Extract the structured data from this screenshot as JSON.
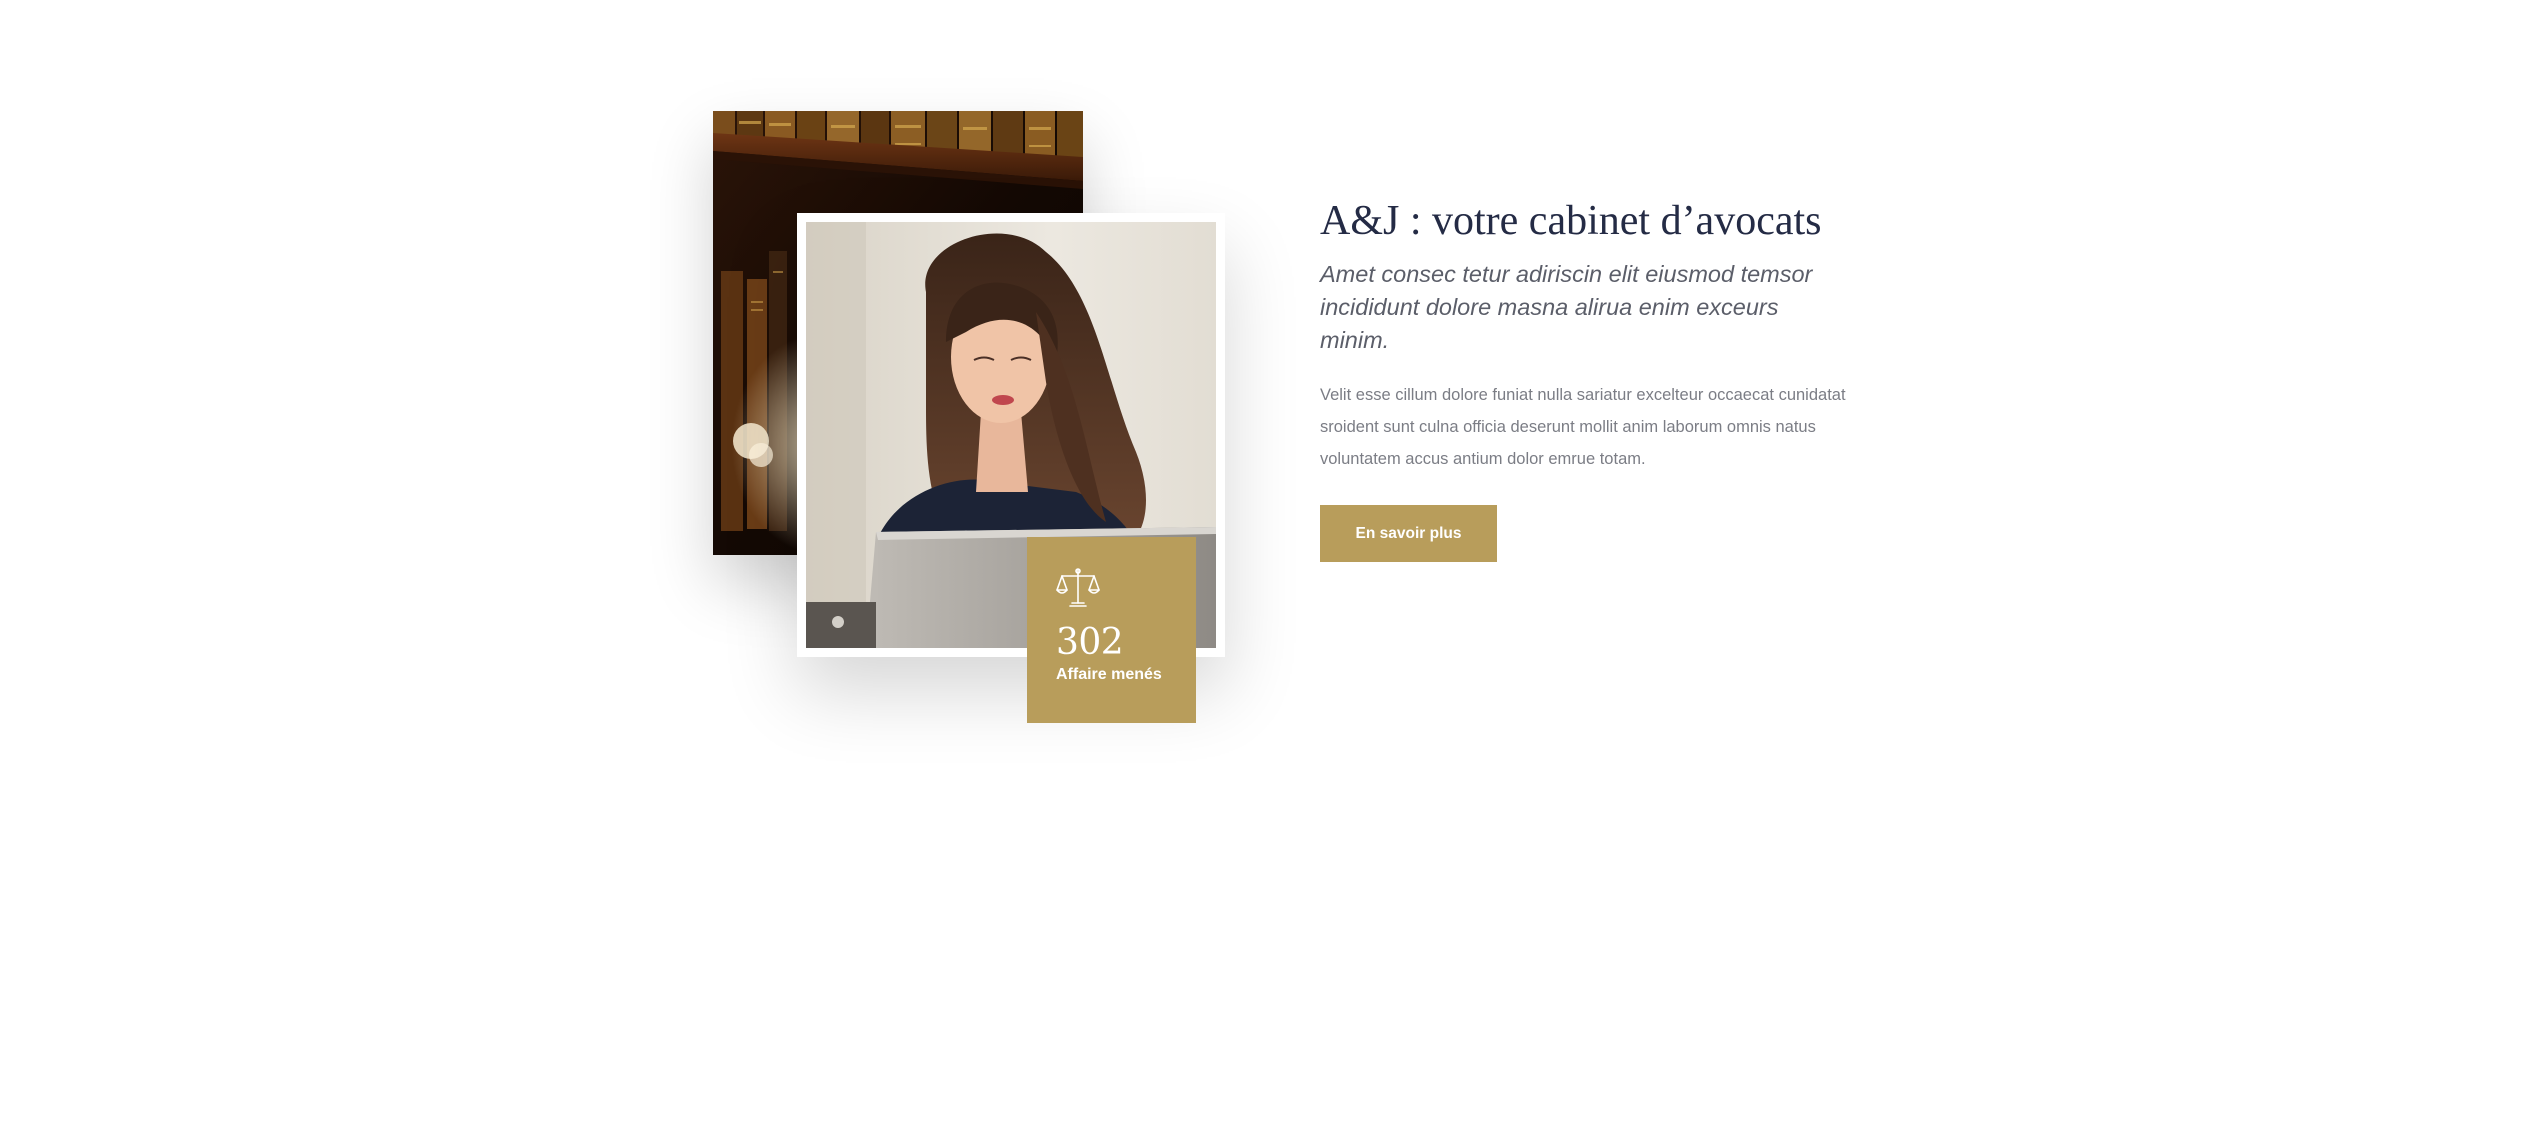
{
  "section": {
    "title": "A&J : votre cabinet d’avocats",
    "lead": "Amet consec tetur adiriscin elit eiusmod temsor incididunt dolore masna alirua enim exceurs minim.",
    "body": "Velit esse cillum dolore funiat nulla sariatur excelteur occaecat cunidatat sroident sunt culna officia deserunt mollit anim laborum omnis natus voluntatem accus antium dolor emrue totam.",
    "cta_label": "En savoir plus"
  },
  "stat": {
    "icon": "scales-of-justice-icon",
    "number": "302",
    "label": "Affaire menés"
  },
  "images": {
    "back": "library-bookshelf-photo",
    "front": "woman-with-laptop-photo"
  },
  "colors": {
    "accent": "#b89d5b",
    "heading": "#242b45",
    "lead": "#5b5e69",
    "body": "#7b7d85",
    "background": "#ffffff"
  }
}
